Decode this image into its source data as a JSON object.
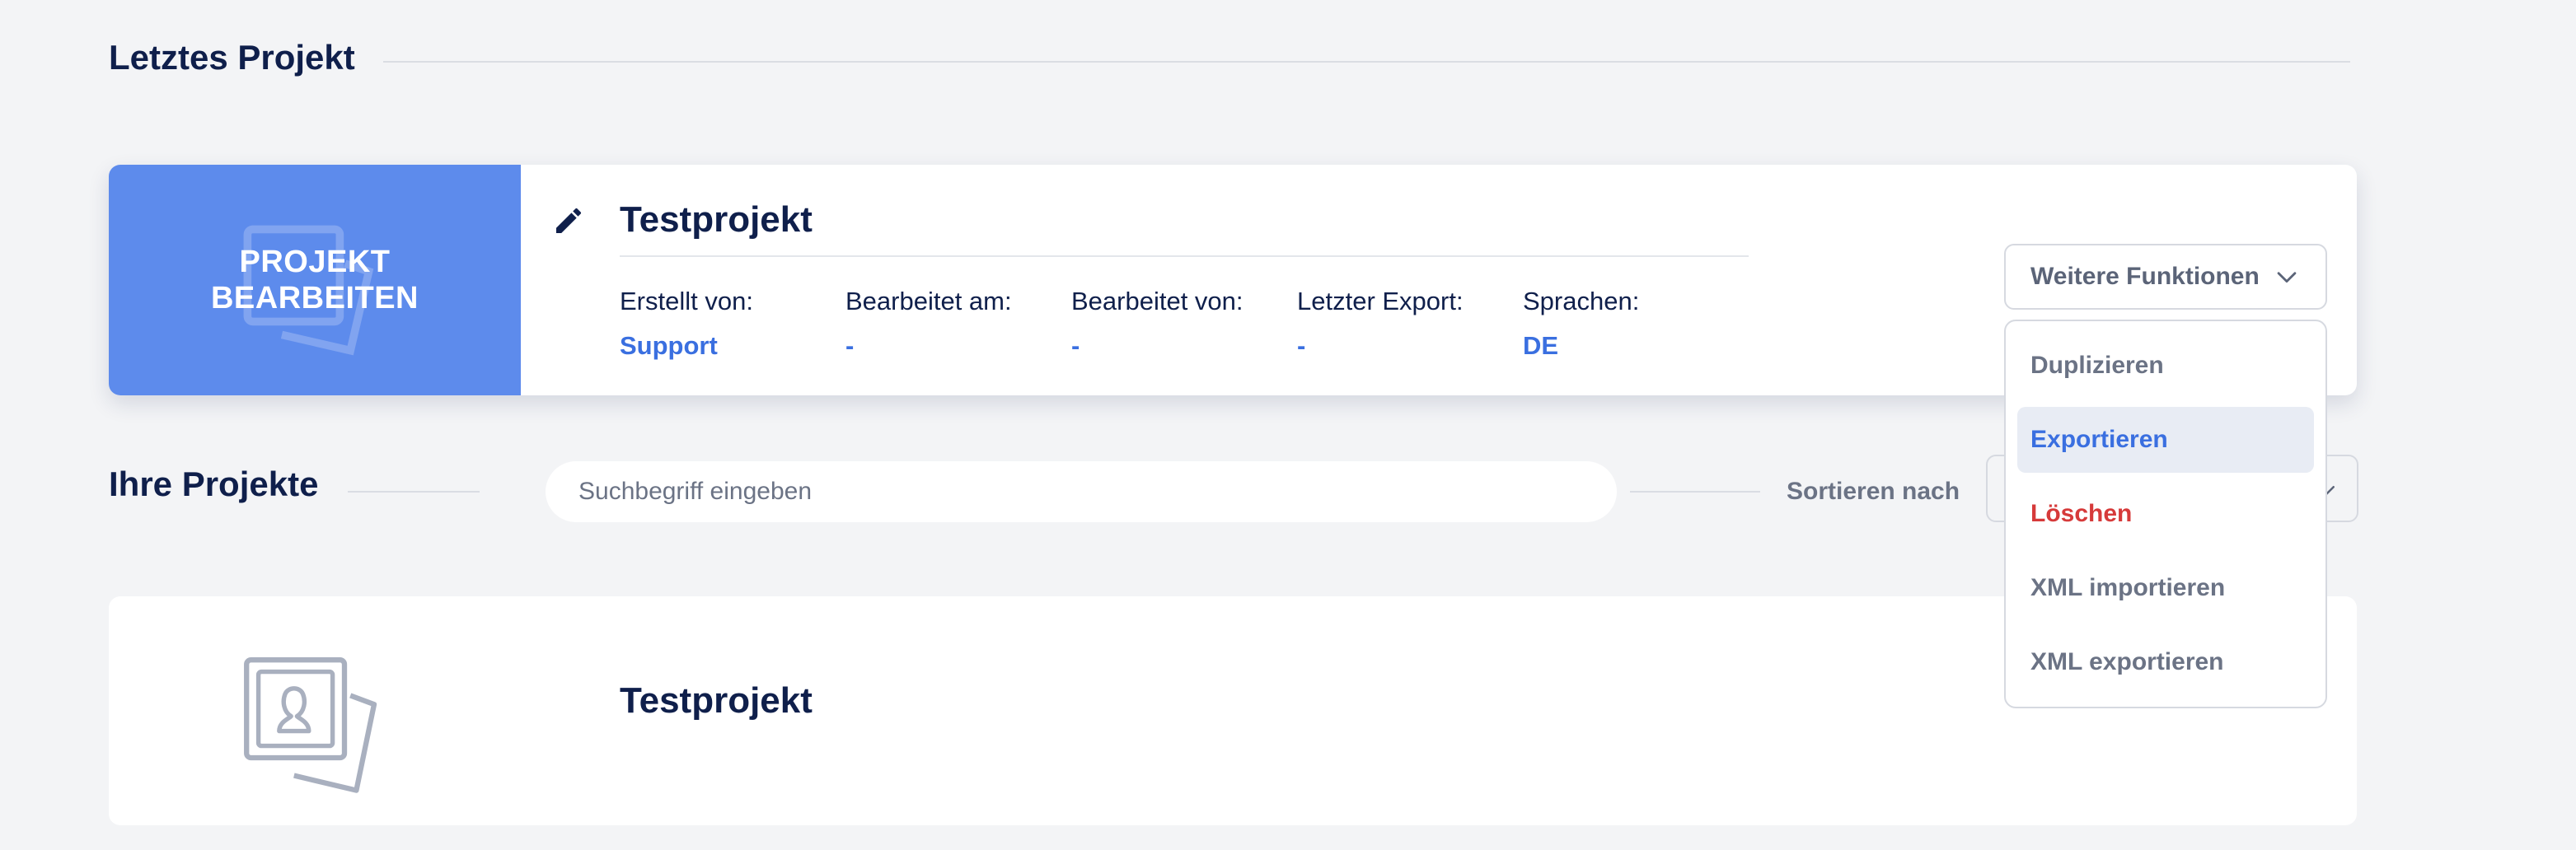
{
  "last_project": {
    "section_title": "Letztes Projekt",
    "edit_button_label_line1": "PROJEKT",
    "edit_button_label_line2": "BEARBEITEN",
    "title": "Testprojekt",
    "meta": [
      {
        "label": "Erstellt von:",
        "value": "Support"
      },
      {
        "label": "Bearbeitet am:",
        "value": "-"
      },
      {
        "label": "Bearbeitet von:",
        "value": "-"
      },
      {
        "label": "Letzter Export:",
        "value": "-"
      },
      {
        "label": "Sprachen:",
        "value": "DE"
      }
    ],
    "more_functions": {
      "label": "Weitere Funktionen",
      "icon": "chevron-down-icon",
      "items": [
        {
          "label": "Duplizieren",
          "state": "normal"
        },
        {
          "label": "Exportieren",
          "state": "hover"
        },
        {
          "label": "Löschen",
          "state": "danger"
        },
        {
          "label": "XML importieren",
          "state": "normal"
        },
        {
          "label": "XML exportieren",
          "state": "normal"
        }
      ]
    }
  },
  "your_projects": {
    "section_title": "Ihre Projekte",
    "search_placeholder": "Suchbegriff eingeben",
    "sort_label": "Sortieren nach",
    "projects": [
      {
        "name": "Testprojekt",
        "thumbnail_icon": "project-placeholder-icon"
      }
    ]
  },
  "colors": {
    "accent": "#3a6fe0",
    "edit_panel": "#5d8bec",
    "danger": "#d63a3a",
    "heading": "#0f1f4b",
    "background": "#f3f4f6"
  }
}
